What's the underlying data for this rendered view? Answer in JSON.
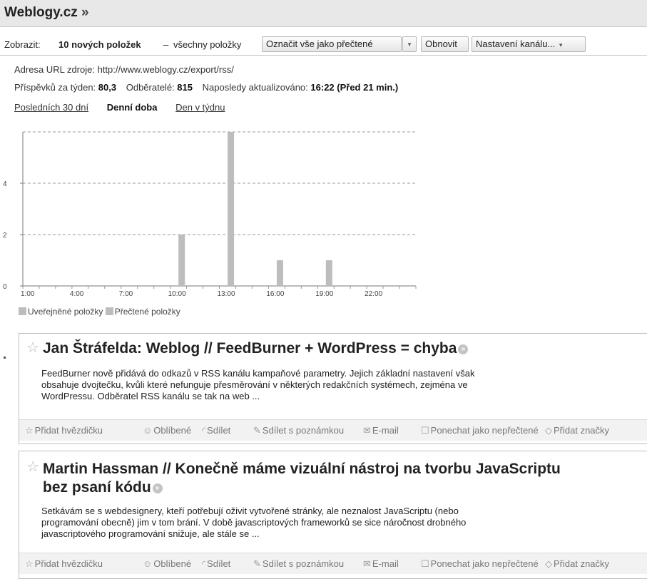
{
  "header": {
    "title": "Weblogy.cz",
    "raquo": "»"
  },
  "toolbar": {
    "show_label": "Zobrazit:",
    "new_items": "10 nových položek",
    "dash": "–",
    "all_items": "všechny položky",
    "mark_all_read": "Označit vše jako přečtené",
    "refresh": "Obnovit",
    "feed_settings": "Nastavení kanálu...",
    "caret": "▾"
  },
  "feed": {
    "url_label": "Adresa URL zdroje:",
    "url": "http://www.weblogy.cz/export/rss/",
    "posts_label": "Příspěvků za týden:",
    "posts_value": "80,3",
    "subscribers_label": "Odběratelé:",
    "subscribers_value": "815",
    "updated_label": "Naposledy aktualizováno:",
    "updated_value": "16:22 (Před 21 min.)",
    "tabs": [
      "Posledních 30 dní",
      "Denní doba",
      "Den v týdnu"
    ]
  },
  "chart_data": {
    "type": "bar",
    "x": [
      0,
      1,
      2,
      3,
      4,
      5,
      6,
      7,
      8,
      9,
      10,
      11,
      12,
      13,
      14,
      15,
      16,
      17,
      18,
      19,
      20,
      21,
      22,
      23
    ],
    "x_tick_labels": [
      "1:00",
      "4:00",
      "7:00",
      "10:00",
      "13:00",
      "16:00",
      "19:00",
      "22:00"
    ],
    "series": [
      {
        "name": "Uveřejněné položky",
        "values": [
          0,
          0,
          0,
          0,
          0,
          0,
          0,
          0,
          0,
          2,
          0,
          0,
          6,
          0,
          0,
          1,
          0,
          0,
          1,
          0,
          0,
          0,
          0,
          0
        ]
      },
      {
        "name": "Přečtené položky",
        "values": []
      }
    ],
    "y_ticks": [
      0,
      2,
      4
    ],
    "ylim": [
      0,
      6
    ],
    "grid": true,
    "legend": "bottom-left",
    "color": "#bdbdbd"
  },
  "entries": [
    {
      "title": "Jan Štráfelda: Weblog // FeedBurner + WordPress = chyba",
      "snippet_lines": [
        "FeedBurner nově přidává do odkazů v RSS kanálu kampaňové parametry. Jejich základní nastavení však",
        "obsahuje dvojtečku, kvůli které nefunguje přesměrování v některých redakčních systémech, zejména ve",
        "WordPressu. Odběratel RSS kanálu se tak na web ..."
      ]
    },
    {
      "title_lines": [
        "Martin Hassman // Konečně máme vizuální nástroj na tvorbu JavaScriptu",
        "bez psaní kódu"
      ],
      "snippet_lines": [
        "Setkávám se s webdesignery, kteří potřebují oživit vytvořené stránky, ale neznalost JavaScriptu (nebo",
        "programování obecně) jim v tom brání. V době javascriptových frameworků se sice náročnost drobného",
        "javascriptového programování snižuje, ale stále se ..."
      ]
    }
  ],
  "actions": {
    "add_star": "Přidat hvězdičku",
    "like": "Oblíbené",
    "share": "Sdílet",
    "share_note": "Sdílet s poznámkou",
    "email": "E-mail",
    "keep_unread": "Ponechat jako nepřečtené",
    "add_tags": "Přidat značky"
  },
  "icons": {
    "star": "☆",
    "like": "☺",
    "share": "◜",
    "note": "✎",
    "email": "✉",
    "checkbox": "☐",
    "tag": "◇",
    "arrow": "»"
  }
}
